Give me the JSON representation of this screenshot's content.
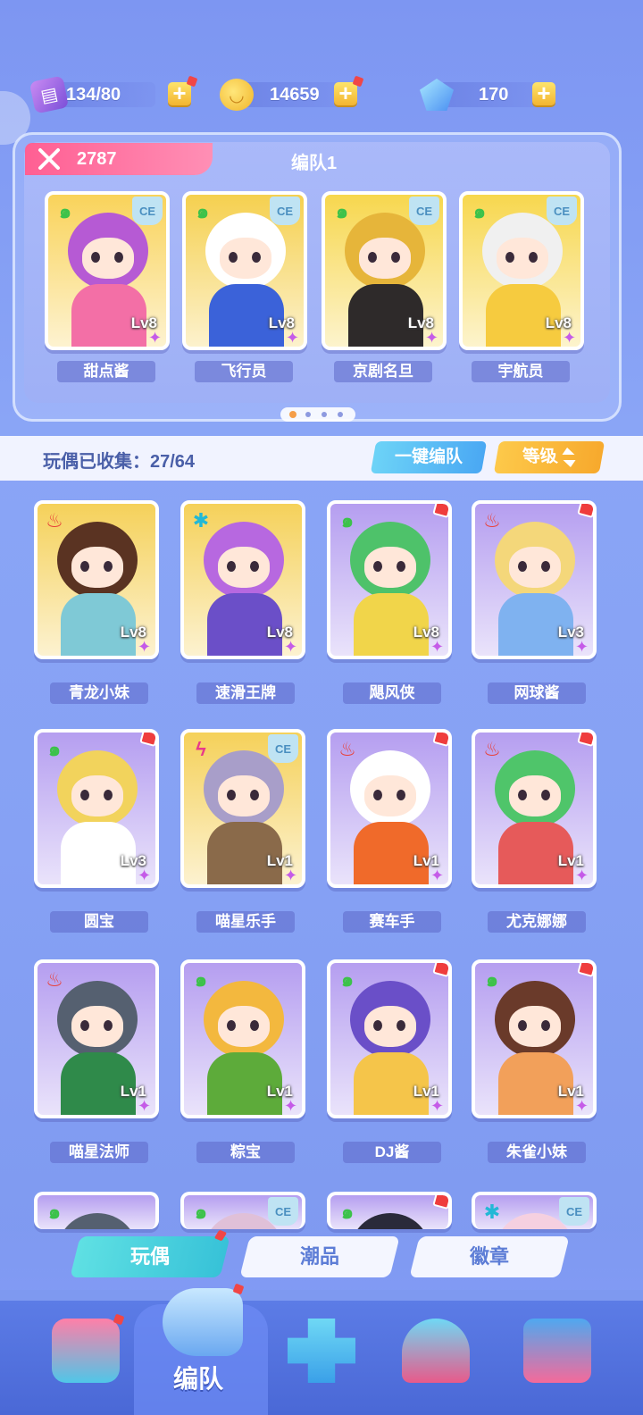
{
  "currency": {
    "tickets": "134/80",
    "coins": "14659",
    "gems": "170"
  },
  "team": {
    "power": "2787",
    "name": "编队1",
    "members": [
      {
        "name": "甜点酱",
        "level": "Lv8",
        "element": "swirl",
        "badge": "CE",
        "head_color": "#b65ad4",
        "body_color": "#f36fa6",
        "bg": "#f9d35a"
      },
      {
        "name": "飞行员",
        "level": "Lv8",
        "element": "swirl",
        "badge": "CE",
        "head_color": "#ffffff",
        "body_color": "#3b62d9",
        "bg": "#f5d04f"
      },
      {
        "name": "京剧名旦",
        "level": "Lv8",
        "element": "swirl",
        "badge": "CE",
        "head_color": "#e6b53a",
        "body_color": "#2e2a2a",
        "bg": "#f7d74e"
      },
      {
        "name": "宇航员",
        "level": "Lv8",
        "element": "swirl",
        "badge": "CE",
        "head_color": "#f0f0f0",
        "body_color": "#f6cb3f",
        "bg": "#f7d74e"
      }
    ]
  },
  "collection": {
    "label": "玩偶已收集：27/64",
    "auto_team": "一键编队",
    "sort": "等级"
  },
  "dolls": [
    {
      "name": "青龙小妹",
      "level": "Lv8",
      "element": "fire",
      "badge": "",
      "gift": false,
      "head_color": "#5a3322",
      "body_color": "#7fc9d6",
      "bg": "#f5d15a"
    },
    {
      "name": "速滑王牌",
      "level": "Lv8",
      "element": "snow",
      "badge": "",
      "gift": false,
      "head_color": "#b768e0",
      "body_color": "#6b4fc8",
      "bg": "#f5d15a"
    },
    {
      "name": "飓风侠",
      "level": "Lv8",
      "element": "swirl",
      "badge": "",
      "gift": true,
      "head_color": "#4ec26a",
      "body_color": "#f1d54a",
      "bg": "#b59ef0"
    },
    {
      "name": "网球酱",
      "level": "Lv3",
      "element": "fire",
      "badge": "",
      "gift": true,
      "head_color": "#f4d77a",
      "body_color": "#7fb2f0",
      "bg": "#b59ef0"
    },
    {
      "name": "圆宝",
      "level": "Lv3",
      "element": "swirl",
      "badge": "",
      "gift": true,
      "head_color": "#f2d35c",
      "body_color": "#ffffff",
      "bg": "#b59ef0"
    },
    {
      "name": "喵星乐手",
      "level": "Lv1",
      "element": "bolt",
      "badge": "CE",
      "gift": false,
      "head_color": "#a89ec9",
      "body_color": "#8a6a4a",
      "bg": "#f5d15a"
    },
    {
      "name": "赛车手",
      "level": "Lv1",
      "element": "fire",
      "badge": "",
      "gift": true,
      "head_color": "#ffffff",
      "body_color": "#f06a2a",
      "bg": "#b59ef0"
    },
    {
      "name": "尤克娜娜",
      "level": "Lv1",
      "element": "fire",
      "badge": "",
      "gift": true,
      "head_color": "#4fc56a",
      "body_color": "#e65a5a",
      "bg": "#b59ef0"
    },
    {
      "name": "喵星法师",
      "level": "Lv1",
      "element": "fire",
      "badge": "",
      "gift": false,
      "head_color": "#556070",
      "body_color": "#2f8a4a",
      "bg": "#b59ef0"
    },
    {
      "name": "粽宝",
      "level": "Lv1",
      "element": "swirl",
      "badge": "",
      "gift": false,
      "head_color": "#f3b83e",
      "body_color": "#5dab3a",
      "bg": "#b59ef0"
    },
    {
      "name": "DJ酱",
      "level": "Lv1",
      "element": "swirl",
      "badge": "",
      "gift": true,
      "head_color": "#6a4fc8",
      "body_color": "#f5c54a",
      "bg": "#b59ef0"
    },
    {
      "name": "朱雀小妹",
      "level": "Lv1",
      "element": "swirl",
      "badge": "",
      "gift": true,
      "head_color": "#6a3a2a",
      "body_color": "#f2a05a",
      "bg": "#b59ef0"
    },
    {
      "name": "",
      "level": "",
      "element": "swirl",
      "badge": "",
      "gift": false,
      "head_color": "#556070",
      "body_color": "#556070",
      "bg": "#b59ef0"
    },
    {
      "name": "",
      "level": "",
      "element": "swirl",
      "badge": "CE",
      "gift": false,
      "head_color": "#e0c0d8",
      "body_color": "#e0c0d8",
      "bg": "#b59ef0"
    },
    {
      "name": "",
      "level": "",
      "element": "swirl",
      "badge": "",
      "gift": true,
      "head_color": "#2a2a3a",
      "body_color": "#2a2a3a",
      "bg": "#b59ef0"
    },
    {
      "name": "",
      "level": "",
      "element": "snow",
      "badge": "CE",
      "gift": false,
      "head_color": "#f5d0e0",
      "body_color": "#f5d0e0",
      "bg": "#b59ef0"
    }
  ],
  "tabs": [
    "玩偶",
    "潮品",
    "徽章"
  ],
  "nav": {
    "active_label": "编队",
    "items": [
      "home-icon",
      "whistle-icon",
      "gamepad-icon",
      "trophy-icon",
      "gift-machine-icon"
    ]
  },
  "colors": {
    "element_swirl": "#3cc24a",
    "element_fire": "#e8413a",
    "element_snow": "#22b8d6",
    "element_bolt": "#e83a8a",
    "star": "#c55be8",
    "accent_pink": "#ff6d9e"
  }
}
